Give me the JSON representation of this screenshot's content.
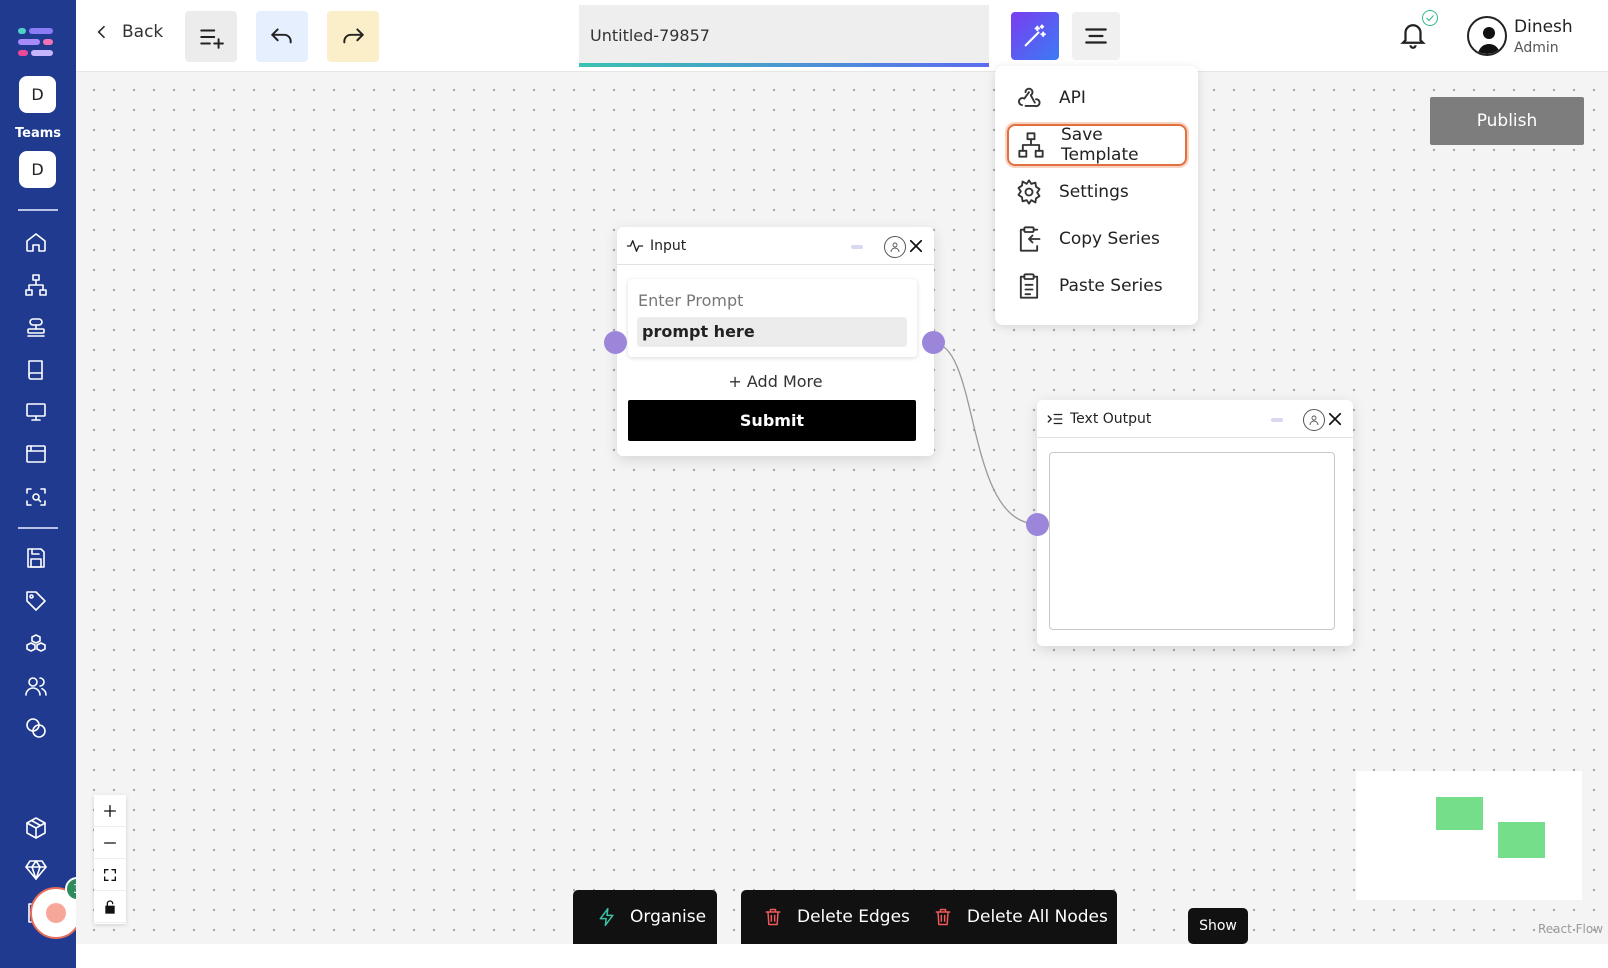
{
  "sidebar": {
    "teams_label": "Teams",
    "team_1_initial": "D",
    "team_2_initial": "D",
    "notification_count": "3"
  },
  "header": {
    "back_label": "Back",
    "document_title": "Untitled-79857",
    "user_name": "Dinesh",
    "user_role": "Admin"
  },
  "publish_label": "Publish",
  "menu": {
    "items": [
      {
        "label": "API",
        "icon": "webhook-icon"
      },
      {
        "label": "Save Template",
        "icon": "sitemap-icon"
      },
      {
        "label": "Settings",
        "icon": "gear-icon"
      },
      {
        "label": "Copy Series",
        "icon": "clipboard-copy-icon"
      },
      {
        "label": "Paste Series",
        "icon": "clipboard-list-icon"
      }
    ]
  },
  "input_node": {
    "title": "Input",
    "prompt_label": "Enter Prompt",
    "prompt_value": "prompt here",
    "add_more_label": "+ Add More",
    "submit_label": "Submit"
  },
  "output_node": {
    "title": "Text Output"
  },
  "toolbar": {
    "organise_label": "Organise",
    "delete_edges_label": "Delete Edges",
    "delete_all_nodes_label": "Delete All Nodes",
    "show_label": "Show"
  },
  "attribution": "React Flow",
  "colors": {
    "sidebar": "#1f3a8f",
    "accent_gradient_start": "#7a3df0",
    "accent_gradient_end": "#3b7bf5",
    "handle": "#9b86da",
    "active_menu_border": "#e2703f",
    "minimap_node": "#74de8a"
  }
}
